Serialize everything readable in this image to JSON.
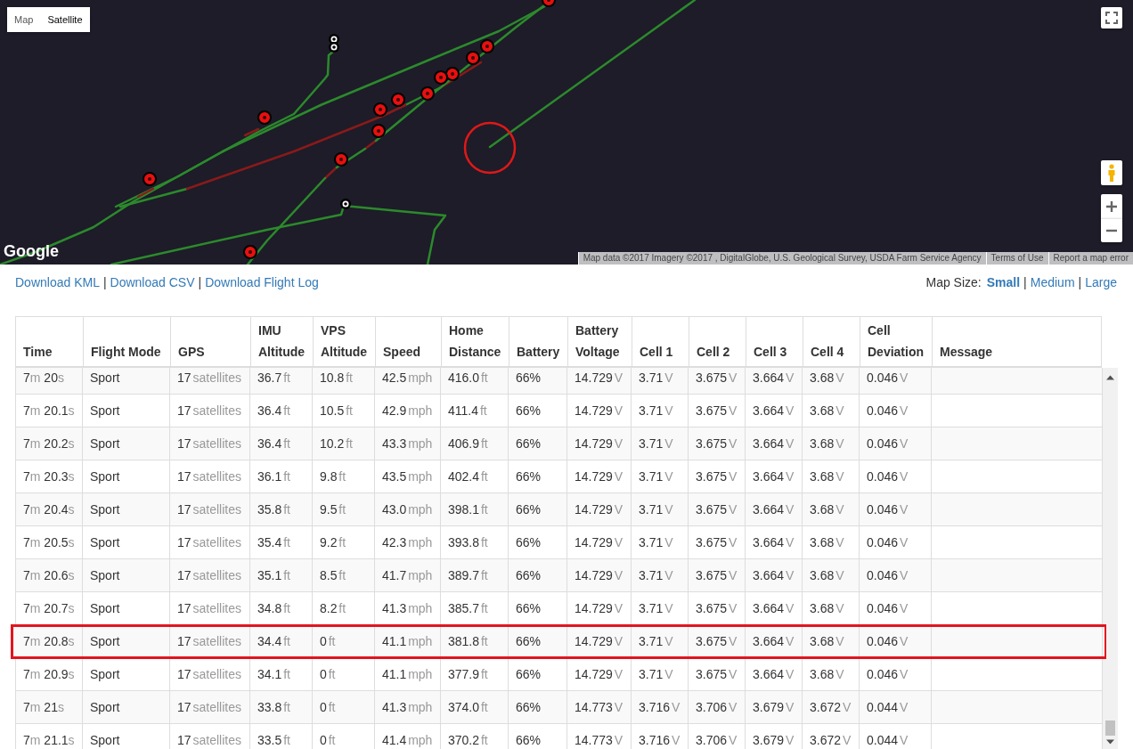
{
  "map": {
    "type_buttons": [
      {
        "label": "Map",
        "selected": false
      },
      {
        "label": "Satellite",
        "selected": true
      }
    ],
    "logo": "Google",
    "attribution": [
      "Map data ©2017 Imagery ©2017 , DigitalGlobe, U.S. Geological Survey, USDA Farm Service Agency",
      "Terms of Use",
      "Report a map error"
    ]
  },
  "downloads": {
    "links": [
      "Download KML",
      "Download CSV",
      "Download Flight Log"
    ],
    "separators": [
      "|",
      "|"
    ]
  },
  "map_size": {
    "label": "Map Size:",
    "options": [
      {
        "label": "Small",
        "selected": true
      },
      {
        "label": "Medium",
        "selected": false
      },
      {
        "label": "Large",
        "selected": false
      }
    ],
    "separators": [
      "|",
      "|"
    ]
  },
  "table": {
    "columns": [
      {
        "label": "Time",
        "kind": "duration"
      },
      {
        "label": "Flight Mode",
        "kind": "text"
      },
      {
        "label": "GPS",
        "kind": "measure"
      },
      {
        "label": "IMU Altitude",
        "kind": "measure"
      },
      {
        "label": "VPS Altitude",
        "kind": "measure"
      },
      {
        "label": "Speed",
        "kind": "measure"
      },
      {
        "label": "Home Distance",
        "kind": "measure"
      },
      {
        "label": "Battery",
        "kind": "text"
      },
      {
        "label": "Battery Voltage",
        "kind": "measure"
      },
      {
        "label": "Cell 1",
        "kind": "measure"
      },
      {
        "label": "Cell 2",
        "kind": "measure"
      },
      {
        "label": "Cell 3",
        "kind": "measure"
      },
      {
        "label": "Cell 4",
        "kind": "measure"
      },
      {
        "label": "Cell Deviation",
        "kind": "measure"
      },
      {
        "label": "Message"
      }
    ],
    "rows": [
      {
        "highlighted": false,
        "cells": [
          [
            [
              "7",
              "m"
            ],
            [
              "20",
              "s"
            ]
          ],
          [
            [
              "Sport"
            ]
          ],
          [
            [
              "17",
              "satellites"
            ]
          ],
          [
            [
              "36.7",
              "ft"
            ]
          ],
          [
            [
              "10.8",
              "ft"
            ]
          ],
          [
            [
              "42.5",
              "mph"
            ]
          ],
          [
            [
              "416.0",
              "ft"
            ]
          ],
          [
            [
              "66%"
            ]
          ],
          [
            [
              "14.729",
              "V"
            ]
          ],
          [
            [
              "3.71",
              "V"
            ]
          ],
          [
            [
              "3.675",
              "V"
            ]
          ],
          [
            [
              "3.664",
              "V"
            ]
          ],
          [
            [
              "3.68",
              "V"
            ]
          ],
          [
            [
              "0.046",
              "V"
            ]
          ]
        ]
      },
      {
        "highlighted": false,
        "cells": [
          [
            [
              "7",
              "m"
            ],
            [
              "20.1",
              "s"
            ]
          ],
          [
            [
              "Sport"
            ]
          ],
          [
            [
              "17",
              "satellites"
            ]
          ],
          [
            [
              "36.4",
              "ft"
            ]
          ],
          [
            [
              "10.5",
              "ft"
            ]
          ],
          [
            [
              "42.9",
              "mph"
            ]
          ],
          [
            [
              "411.4",
              "ft"
            ]
          ],
          [
            [
              "66%"
            ]
          ],
          [
            [
              "14.729",
              "V"
            ]
          ],
          [
            [
              "3.71",
              "V"
            ]
          ],
          [
            [
              "3.675",
              "V"
            ]
          ],
          [
            [
              "3.664",
              "V"
            ]
          ],
          [
            [
              "3.68",
              "V"
            ]
          ],
          [
            [
              "0.046",
              "V"
            ]
          ]
        ]
      },
      {
        "highlighted": false,
        "cells": [
          [
            [
              "7",
              "m"
            ],
            [
              "20.2",
              "s"
            ]
          ],
          [
            [
              "Sport"
            ]
          ],
          [
            [
              "17",
              "satellites"
            ]
          ],
          [
            [
              "36.4",
              "ft"
            ]
          ],
          [
            [
              "10.2",
              "ft"
            ]
          ],
          [
            [
              "43.3",
              "mph"
            ]
          ],
          [
            [
              "406.9",
              "ft"
            ]
          ],
          [
            [
              "66%"
            ]
          ],
          [
            [
              "14.729",
              "V"
            ]
          ],
          [
            [
              "3.71",
              "V"
            ]
          ],
          [
            [
              "3.675",
              "V"
            ]
          ],
          [
            [
              "3.664",
              "V"
            ]
          ],
          [
            [
              "3.68",
              "V"
            ]
          ],
          [
            [
              "0.046",
              "V"
            ]
          ]
        ]
      },
      {
        "highlighted": false,
        "cells": [
          [
            [
              "7",
              "m"
            ],
            [
              "20.3",
              "s"
            ]
          ],
          [
            [
              "Sport"
            ]
          ],
          [
            [
              "17",
              "satellites"
            ]
          ],
          [
            [
              "36.1",
              "ft"
            ]
          ],
          [
            [
              "9.8",
              "ft"
            ]
          ],
          [
            [
              "43.5",
              "mph"
            ]
          ],
          [
            [
              "402.4",
              "ft"
            ]
          ],
          [
            [
              "66%"
            ]
          ],
          [
            [
              "14.729",
              "V"
            ]
          ],
          [
            [
              "3.71",
              "V"
            ]
          ],
          [
            [
              "3.675",
              "V"
            ]
          ],
          [
            [
              "3.664",
              "V"
            ]
          ],
          [
            [
              "3.68",
              "V"
            ]
          ],
          [
            [
              "0.046",
              "V"
            ]
          ]
        ]
      },
      {
        "highlighted": false,
        "cells": [
          [
            [
              "7",
              "m"
            ],
            [
              "20.4",
              "s"
            ]
          ],
          [
            [
              "Sport"
            ]
          ],
          [
            [
              "17",
              "satellites"
            ]
          ],
          [
            [
              "35.8",
              "ft"
            ]
          ],
          [
            [
              "9.5",
              "ft"
            ]
          ],
          [
            [
              "43.0",
              "mph"
            ]
          ],
          [
            [
              "398.1",
              "ft"
            ]
          ],
          [
            [
              "66%"
            ]
          ],
          [
            [
              "14.729",
              "V"
            ]
          ],
          [
            [
              "3.71",
              "V"
            ]
          ],
          [
            [
              "3.675",
              "V"
            ]
          ],
          [
            [
              "3.664",
              "V"
            ]
          ],
          [
            [
              "3.68",
              "V"
            ]
          ],
          [
            [
              "0.046",
              "V"
            ]
          ]
        ]
      },
      {
        "highlighted": false,
        "cells": [
          [
            [
              "7",
              "m"
            ],
            [
              "20.5",
              "s"
            ]
          ],
          [
            [
              "Sport"
            ]
          ],
          [
            [
              "17",
              "satellites"
            ]
          ],
          [
            [
              "35.4",
              "ft"
            ]
          ],
          [
            [
              "9.2",
              "ft"
            ]
          ],
          [
            [
              "42.3",
              "mph"
            ]
          ],
          [
            [
              "393.8",
              "ft"
            ]
          ],
          [
            [
              "66%"
            ]
          ],
          [
            [
              "14.729",
              "V"
            ]
          ],
          [
            [
              "3.71",
              "V"
            ]
          ],
          [
            [
              "3.675",
              "V"
            ]
          ],
          [
            [
              "3.664",
              "V"
            ]
          ],
          [
            [
              "3.68",
              "V"
            ]
          ],
          [
            [
              "0.046",
              "V"
            ]
          ]
        ]
      },
      {
        "highlighted": false,
        "cells": [
          [
            [
              "7",
              "m"
            ],
            [
              "20.6",
              "s"
            ]
          ],
          [
            [
              "Sport"
            ]
          ],
          [
            [
              "17",
              "satellites"
            ]
          ],
          [
            [
              "35.1",
              "ft"
            ]
          ],
          [
            [
              "8.5",
              "ft"
            ]
          ],
          [
            [
              "41.7",
              "mph"
            ]
          ],
          [
            [
              "389.7",
              "ft"
            ]
          ],
          [
            [
              "66%"
            ]
          ],
          [
            [
              "14.729",
              "V"
            ]
          ],
          [
            [
              "3.71",
              "V"
            ]
          ],
          [
            [
              "3.675",
              "V"
            ]
          ],
          [
            [
              "3.664",
              "V"
            ]
          ],
          [
            [
              "3.68",
              "V"
            ]
          ],
          [
            [
              "0.046",
              "V"
            ]
          ]
        ]
      },
      {
        "highlighted": false,
        "cells": [
          [
            [
              "7",
              "m"
            ],
            [
              "20.7",
              "s"
            ]
          ],
          [
            [
              "Sport"
            ]
          ],
          [
            [
              "17",
              "satellites"
            ]
          ],
          [
            [
              "34.8",
              "ft"
            ]
          ],
          [
            [
              "8.2",
              "ft"
            ]
          ],
          [
            [
              "41.3",
              "mph"
            ]
          ],
          [
            [
              "385.7",
              "ft"
            ]
          ],
          [
            [
              "66%"
            ]
          ],
          [
            [
              "14.729",
              "V"
            ]
          ],
          [
            [
              "3.71",
              "V"
            ]
          ],
          [
            [
              "3.675",
              "V"
            ]
          ],
          [
            [
              "3.664",
              "V"
            ]
          ],
          [
            [
              "3.68",
              "V"
            ]
          ],
          [
            [
              "0.046",
              "V"
            ]
          ]
        ]
      },
      {
        "highlighted": true,
        "cells": [
          [
            [
              "7",
              "m"
            ],
            [
              "20.8",
              "s"
            ]
          ],
          [
            [
              "Sport"
            ]
          ],
          [
            [
              "17",
              "satellites"
            ]
          ],
          [
            [
              "34.4",
              "ft"
            ]
          ],
          [
            [
              "0",
              "ft"
            ]
          ],
          [
            [
              "41.1",
              "mph"
            ]
          ],
          [
            [
              "381.8",
              "ft"
            ]
          ],
          [
            [
              "66%"
            ]
          ],
          [
            [
              "14.729",
              "V"
            ]
          ],
          [
            [
              "3.71",
              "V"
            ]
          ],
          [
            [
              "3.675",
              "V"
            ]
          ],
          [
            [
              "3.664",
              "V"
            ]
          ],
          [
            [
              "3.68",
              "V"
            ]
          ],
          [
            [
              "0.046",
              "V"
            ]
          ]
        ]
      },
      {
        "highlighted": false,
        "cells": [
          [
            [
              "7",
              "m"
            ],
            [
              "20.9",
              "s"
            ]
          ],
          [
            [
              "Sport"
            ]
          ],
          [
            [
              "17",
              "satellites"
            ]
          ],
          [
            [
              "34.1",
              "ft"
            ]
          ],
          [
            [
              "0",
              "ft"
            ]
          ],
          [
            [
              "41.1",
              "mph"
            ]
          ],
          [
            [
              "377.9",
              "ft"
            ]
          ],
          [
            [
              "66%"
            ]
          ],
          [
            [
              "14.729",
              "V"
            ]
          ],
          [
            [
              "3.71",
              "V"
            ]
          ],
          [
            [
              "3.675",
              "V"
            ]
          ],
          [
            [
              "3.664",
              "V"
            ]
          ],
          [
            [
              "3.68",
              "V"
            ]
          ],
          [
            [
              "0.046",
              "V"
            ]
          ]
        ]
      },
      {
        "highlighted": false,
        "cells": [
          [
            [
              "7",
              "m"
            ],
            [
              "21",
              "s"
            ]
          ],
          [
            [
              "Sport"
            ]
          ],
          [
            [
              "17",
              "satellites"
            ]
          ],
          [
            [
              "33.8",
              "ft"
            ]
          ],
          [
            [
              "0",
              "ft"
            ]
          ],
          [
            [
              "41.3",
              "mph"
            ]
          ],
          [
            [
              "374.0",
              "ft"
            ]
          ],
          [
            [
              "66%"
            ]
          ],
          [
            [
              "14.773",
              "V"
            ]
          ],
          [
            [
              "3.716",
              "V"
            ]
          ],
          [
            [
              "3.706",
              "V"
            ]
          ],
          [
            [
              "3.679",
              "V"
            ]
          ],
          [
            [
              "3.672",
              "V"
            ]
          ],
          [
            [
              "0.044",
              "V"
            ]
          ]
        ]
      },
      {
        "highlighted": false,
        "cells": [
          [
            [
              "7",
              "m"
            ],
            [
              "21.1",
              "s"
            ]
          ],
          [
            [
              "Sport"
            ]
          ],
          [
            [
              "17",
              "satellites"
            ]
          ],
          [
            [
              "33.5",
              "ft"
            ]
          ],
          [
            [
              "0",
              "ft"
            ]
          ],
          [
            [
              "41.4",
              "mph"
            ]
          ],
          [
            [
              "370.2",
              "ft"
            ]
          ],
          [
            [
              "66%"
            ]
          ],
          [
            [
              "14.773",
              "V"
            ]
          ],
          [
            [
              "3.716",
              "V"
            ]
          ],
          [
            [
              "3.706",
              "V"
            ]
          ],
          [
            [
              "3.679",
              "V"
            ]
          ],
          [
            [
              "3.672",
              "V"
            ]
          ],
          [
            [
              "0.044",
              "V"
            ]
          ]
        ]
      }
    ]
  }
}
